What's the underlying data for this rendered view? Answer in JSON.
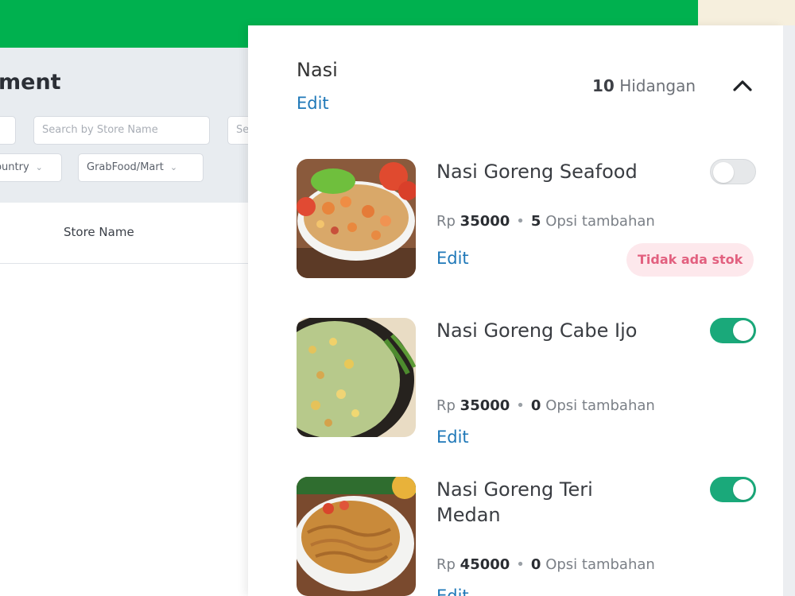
{
  "background_page": {
    "title": "ment",
    "search_store_placeholder": "Search by Store Name",
    "search_other_placeholder": "Se",
    "country_filter": "Country",
    "channel_filter": "GrabFood/Mart",
    "table_header": "Store Name"
  },
  "category": {
    "name": "Nasi",
    "edit_label": "Edit",
    "count_number": "10",
    "count_label": "Hidangan"
  },
  "dishes": [
    {
      "name": "Nasi Goreng Seafood",
      "currency": "Rp",
      "price": "35000",
      "options_count": "5",
      "options_label": "Opsi tambahan",
      "edit_label": "Edit",
      "enabled": false,
      "badge": "Tidak ada stok"
    },
    {
      "name": "Nasi Goreng Cabe Ijo",
      "currency": "Rp",
      "price": "35000",
      "options_count": "0",
      "options_label": "Opsi tambahan",
      "edit_label": "Edit",
      "enabled": true
    },
    {
      "name": "Nasi Goreng Teri Medan",
      "currency": "Rp",
      "price": "45000",
      "options_count": "0",
      "options_label": "Opsi tambahan",
      "edit_label": "Edit",
      "enabled": true
    }
  ],
  "colors": {
    "brand_green": "#00b14f",
    "toggle_on": "#1aa97a",
    "link_blue": "#1f78b8",
    "badge_text": "#e2607f",
    "badge_bg": "#fde8ec"
  },
  "icons": {
    "collapse": "chevron-up-icon",
    "dropdown": "chevron-down-icon"
  }
}
